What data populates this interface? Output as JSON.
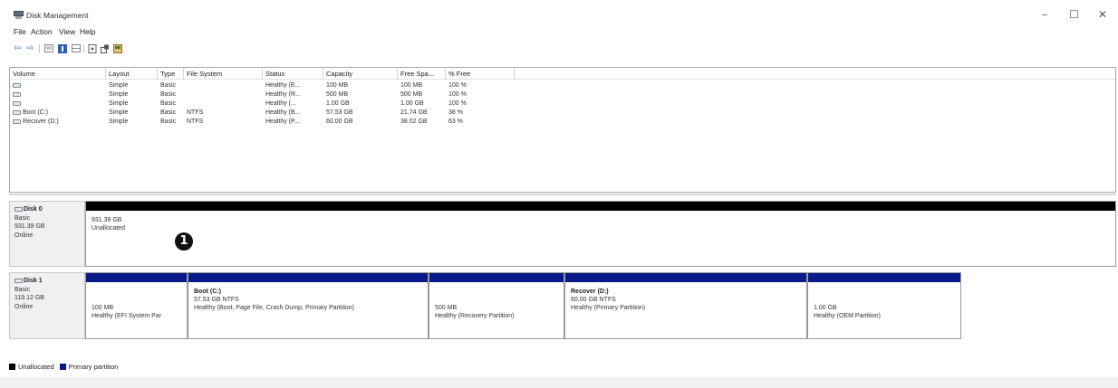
{
  "window": {
    "title": "Disk Management",
    "controls": {
      "minimize": "–",
      "maximize": "☐",
      "close": "✕"
    }
  },
  "menu": [
    "File",
    "Action",
    "View",
    "Help"
  ],
  "toolbar": {
    "icons": [
      "back-arrow-icon",
      "forward-arrow-icon",
      "volume-list-icon",
      "help-icon",
      "disk-list-icon",
      "properties-icon",
      "settings-icon",
      "rescan-icon"
    ]
  },
  "volume_list": {
    "columns": [
      "Volume",
      "Layout",
      "Type",
      "File System",
      "Status",
      "Capacity",
      "Free Spa...",
      "% Free"
    ],
    "rows": [
      [
        "",
        "Simple",
        "Basic",
        "",
        "Healthy (E...",
        "100 MB",
        "100 MB",
        "100 %"
      ],
      [
        "",
        "Simple",
        "Basic",
        "",
        "Healthy (R...",
        "500 MB",
        "500 MB",
        "100 %"
      ],
      [
        "",
        "Simple",
        "Basic",
        "",
        "Healthy (...",
        "1.00 GB",
        "1.00 GB",
        "100 %"
      ],
      [
        "Boot (C:)",
        "Simple",
        "Basic",
        "NTFS",
        "Healthy (B...",
        "57.53 GB",
        "21.74 GB",
        "38 %"
      ],
      [
        "Recover (D:)",
        "Simple",
        "Basic",
        "NTFS",
        "Healthy (P...",
        "60.00 GB",
        "38.02 GB",
        "63 %"
      ]
    ]
  },
  "disks": [
    {
      "name": "Disk 0",
      "type": "Basic",
      "size": "931.39 GB",
      "state": "Online",
      "partitions": [
        {
          "name": "",
          "line1": "931.39 GB",
          "line2": "Unallocated",
          "band_color": "#000000"
        }
      ],
      "callout": "1"
    },
    {
      "name": "Disk 1",
      "type": "Basic",
      "size": "119.12 GB",
      "state": "Online",
      "partitions": [
        {
          "name": "",
          "line1": "100 MB",
          "line2": "Healthy (EFI System Par",
          "band_color": "#0a1a8a"
        },
        {
          "name": "Boot  (C:)",
          "line1": "57.53 GB NTFS",
          "line2": "Healthy (Boot, Page File, Crash Dump, Primary Partition)",
          "band_color": "#0a1a8a"
        },
        {
          "name": "",
          "line1": "500 MB",
          "line2": "Healthy (Recovery Partition)",
          "band_color": "#0a1a8a"
        },
        {
          "name": "Recover  (D:)",
          "line1": "60.00 GB NTFS",
          "line2": "Healthy (Primary Partition)",
          "band_color": "#0a1a8a"
        },
        {
          "name": "",
          "line1": "1.00 GB",
          "line2": "Healthy (OEM Partition)",
          "band_color": "#0a1a8a"
        }
      ]
    }
  ],
  "legend": [
    {
      "label": "Unallocated",
      "color": "#000000"
    },
    {
      "label": "Primary partition",
      "color": "#0a1a8a"
    }
  ]
}
